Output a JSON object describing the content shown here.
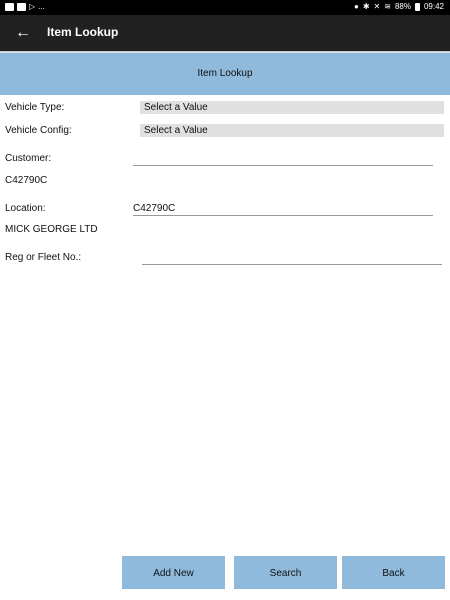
{
  "status_bar": {
    "left_text": "...",
    "battery": "88%",
    "time": "09:42"
  },
  "app_bar": {
    "title": "Item Lookup"
  },
  "page_header": {
    "title": "Item Lookup"
  },
  "form": {
    "vehicle_type": {
      "label": "Vehicle Type:",
      "value": "Select a Value"
    },
    "vehicle_config": {
      "label": "Vehicle Config:",
      "value": "Select a Value"
    },
    "customer": {
      "label": "Customer:",
      "input_value": "",
      "sub_value": "C42790C"
    },
    "location": {
      "label": "Location:",
      "input_value": "C42790C",
      "sub_value": "MICK GEORGE LTD"
    },
    "reg_fleet": {
      "label": "Reg or Fleet No.:",
      "input_value": ""
    }
  },
  "buttons": {
    "add_new": "Add New",
    "search": "Search",
    "back": "Back"
  },
  "colors": {
    "header_band": "#8fbadc",
    "app_bar": "#212121",
    "select_bg": "#e0e0e0"
  }
}
